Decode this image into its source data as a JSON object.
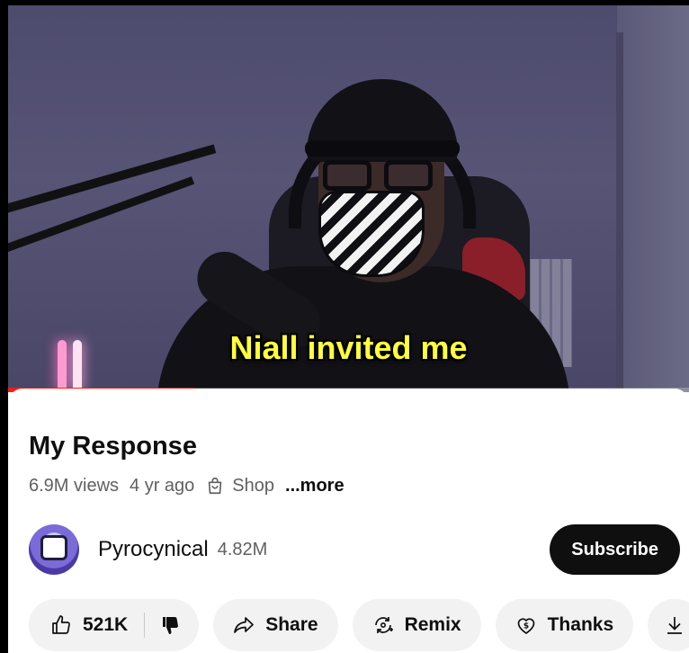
{
  "video": {
    "caption": "Niall invited me",
    "progress_fraction": 0.275
  },
  "info": {
    "title": "My Response",
    "views": "6.9M views",
    "age": "4 yr ago",
    "shop_label": "Shop",
    "more_label": "...more"
  },
  "channel": {
    "name": "Pyrocynical",
    "subscribers": "4.82M",
    "subscribe_label": "Subscribe"
  },
  "actions": {
    "like_count": "521K",
    "share_label": "Share",
    "remix_label": "Remix",
    "thanks_label": "Thanks"
  },
  "icons": [
    "thumbs-up-icon",
    "thumbs-down-icon",
    "share-icon",
    "remix-icon",
    "thanks-icon",
    "download-icon",
    "shopping-bag-icon"
  ],
  "colors": {
    "caption": "#ffff3c",
    "progress": "#ff1a1a",
    "subscribe_bg": "#0f0f0f",
    "pill_bg": "#f2f2f2"
  }
}
